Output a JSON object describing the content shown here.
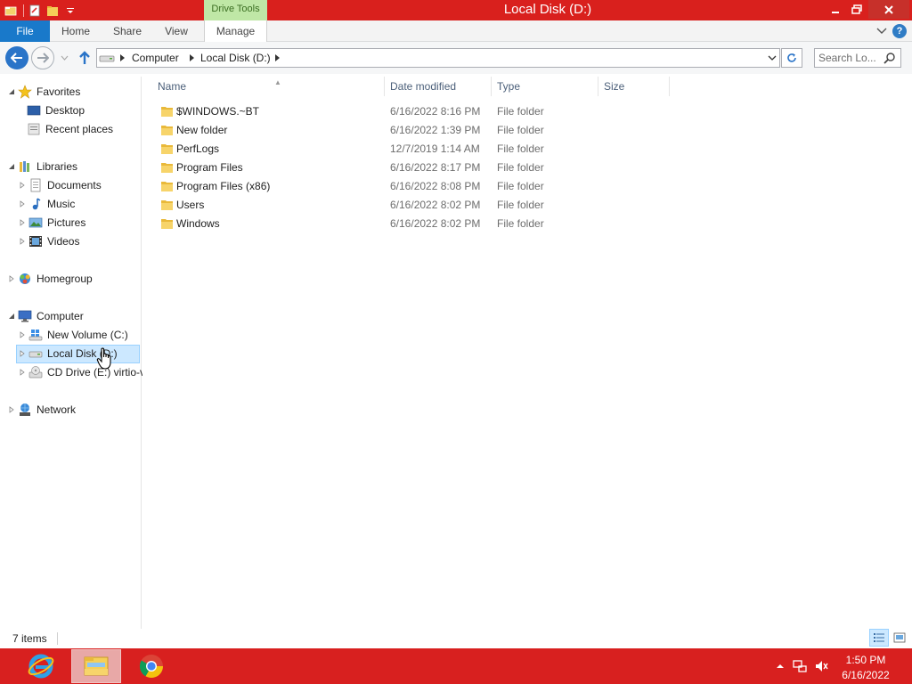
{
  "window": {
    "title": "Local Disk (D:)",
    "context_tab_group": "Drive Tools"
  },
  "ribbon": {
    "tabs": [
      {
        "label": "File"
      },
      {
        "label": "Home"
      },
      {
        "label": "Share"
      },
      {
        "label": "View"
      },
      {
        "label": "Manage"
      }
    ]
  },
  "address": {
    "crumbs": [
      "Computer",
      "Local Disk (D:)"
    ],
    "search_placeholder": "Search Lo..."
  },
  "nav": {
    "favorites": {
      "label": "Favorites",
      "items": [
        {
          "label": "Desktop"
        },
        {
          "label": "Recent places"
        }
      ]
    },
    "libraries": {
      "label": "Libraries",
      "items": [
        {
          "label": "Documents"
        },
        {
          "label": "Music"
        },
        {
          "label": "Pictures"
        },
        {
          "label": "Videos"
        }
      ]
    },
    "homegroup": {
      "label": "Homegroup"
    },
    "computer": {
      "label": "Computer",
      "items": [
        {
          "label": "New Volume (C:)"
        },
        {
          "label": "Local Disk (D:)"
        },
        {
          "label": "CD Drive (E:) virtio-v"
        }
      ]
    },
    "network": {
      "label": "Network"
    }
  },
  "columns": {
    "name": "Name",
    "date_modified": "Date modified",
    "type": "Type",
    "size": "Size"
  },
  "files": [
    {
      "name": "$WINDOWS.~BT",
      "date": "6/16/2022 8:16 PM",
      "type": "File folder"
    },
    {
      "name": "New folder",
      "date": "6/16/2022 1:39 PM",
      "type": "File folder"
    },
    {
      "name": "PerfLogs",
      "date": "12/7/2019 1:14 AM",
      "type": "File folder"
    },
    {
      "name": "Program Files",
      "date": "6/16/2022 8:17 PM",
      "type": "File folder"
    },
    {
      "name": "Program Files (x86)",
      "date": "6/16/2022 8:08 PM",
      "type": "File folder"
    },
    {
      "name": "Users",
      "date": "6/16/2022 8:02 PM",
      "type": "File folder"
    },
    {
      "name": "Windows",
      "date": "6/16/2022 8:02 PM",
      "type": "File folder"
    }
  ],
  "status": {
    "item_count": "7 items"
  },
  "clock": {
    "time": "1:50 PM",
    "date": "6/16/2022"
  },
  "colors": {
    "titlebar": "#d9201d",
    "taskbar": "#d8201f",
    "accent": "#1979ca",
    "context_tab": "#bfe7a6"
  }
}
